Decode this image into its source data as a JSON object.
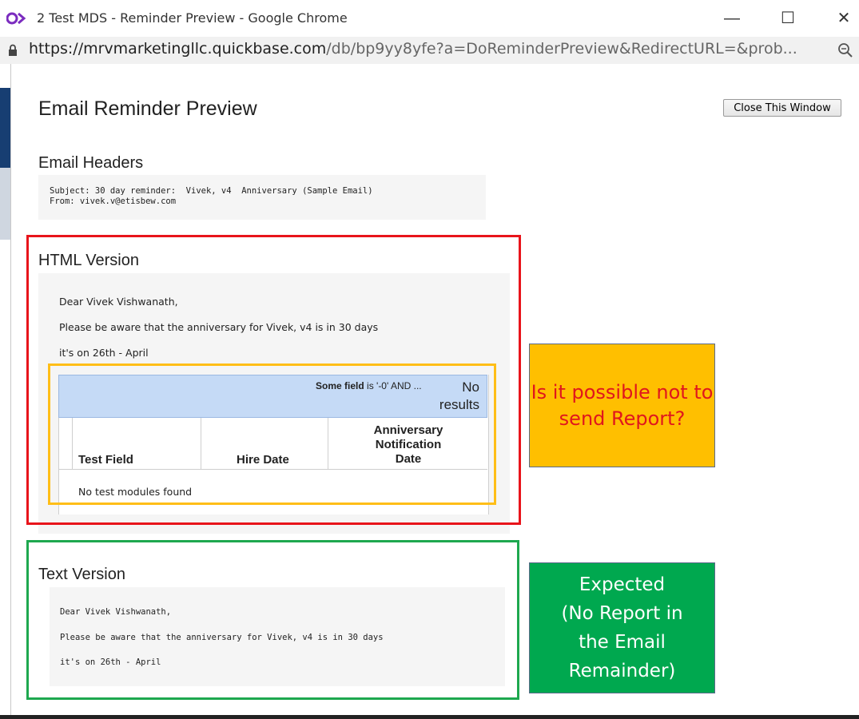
{
  "window": {
    "title": "2 Test MDS - Reminder Preview - Google Chrome",
    "minimize_glyph": "—",
    "maximize_glyph": "☐",
    "close_glyph": "✕"
  },
  "address_bar": {
    "url_host": "https://mrvmarketingllc.quickbase.com",
    "url_path": "/db/bp9yy8yfe?a=DoReminderPreview&RedirectURL=&prob..."
  },
  "page": {
    "title": "Email Reminder Preview",
    "close_button": "Close This Window"
  },
  "email_headers": {
    "title": "Email Headers",
    "subject_line": "Subject: 30 day reminder:  Vivek, v4  Anniversary (Sample Email)",
    "from_line": "From: vivek.v@etisbew.com"
  },
  "html_version": {
    "title": "HTML Version",
    "greeting": "Dear Vivek Vishwanath,",
    "body_line": "Please be aware that the anniversary for Vivek, v4 is in 30 days",
    "date_line": "it's on 26th - April",
    "report": {
      "criteria_field": "Some field",
      "criteria_rest": " is '-0' AND ...",
      "no_results_1": "No",
      "no_results_2": "results",
      "columns": [
        "Test Field",
        "Hire Date",
        "Anniversary",
        "Notification",
        "Date"
      ],
      "empty_message": "No test modules found"
    }
  },
  "text_version": {
    "title": "Text Version",
    "greeting": "Dear Vivek Vishwanath,",
    "body_line": "Please be aware that the anniversary for Vivek, v4 is in 30 days",
    "date_line": "it's on 26th - April"
  },
  "annotations": {
    "question": "Is it possible not to send Report?",
    "expected": "Expected\n(No Report in\nthe Email\nRemainder)"
  },
  "colors": {
    "red_frame": "#e8141b",
    "yellow_frame": "#ffbe17",
    "green_frame": "#1ea84f",
    "orange_callout": "#ffbf00",
    "green_callout": "#00a84f"
  }
}
